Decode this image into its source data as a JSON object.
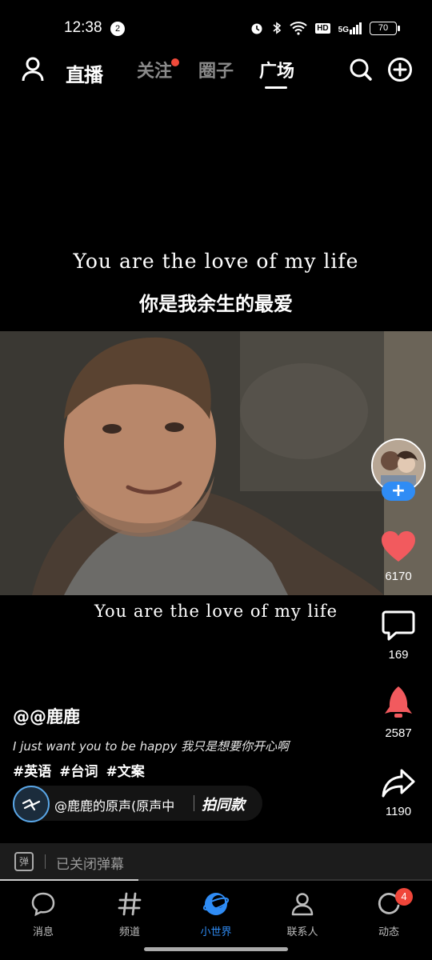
{
  "status_bar": {
    "time": "12:38",
    "notification_count": "2",
    "network": "5G",
    "hd": "HD",
    "battery": "70"
  },
  "top_nav": {
    "live_label": "直播",
    "tabs": [
      {
        "label": "关注",
        "has_dot": true
      },
      {
        "label": "圈子",
        "has_dot": false
      },
      {
        "label": "广场",
        "active": true
      }
    ]
  },
  "video": {
    "caption_en": "You are the love of my life",
    "caption_zh": "你是我余生的最爱",
    "subtitle_en": "You are the love of my life",
    "progress": 0.32
  },
  "actions": {
    "likes": "6170",
    "comments": "169",
    "boosts": "2587",
    "shares": "1190",
    "follow_symbol": "+"
  },
  "post": {
    "author": "@@鹿鹿",
    "description": "I just want you to be happy 我只是想要你开心啊",
    "hashtags": [
      "#英语",
      "#台词",
      "#文案"
    ],
    "music": "@鹿鹿的原声(原声中",
    "same_style": "拍同款"
  },
  "danmaku": {
    "icon_text": "弹",
    "label": "已关闭弹幕"
  },
  "bottom_nav": [
    {
      "label": "消息",
      "icon": "message-icon"
    },
    {
      "label": "频道",
      "icon": "hashtag-icon"
    },
    {
      "label": "小世界",
      "icon": "small-world-icon",
      "active": true
    },
    {
      "label": "联系人",
      "icon": "contacts-icon"
    },
    {
      "label": "动态",
      "icon": "activity-icon",
      "badge": "4"
    }
  ],
  "colors": {
    "accent_blue": "#2f8cf5",
    "like_red": "#f25a5e",
    "badge_red": "#f0463a"
  }
}
